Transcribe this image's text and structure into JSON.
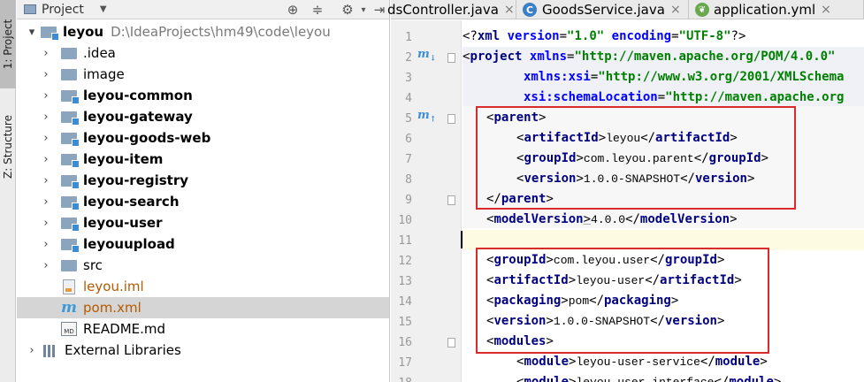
{
  "tool_strip": {
    "project_tab": "1: Project",
    "structure_tab": "Z: Structure"
  },
  "project_panel": {
    "title": "Project",
    "tree": [
      {
        "label": "leyou",
        "path": "D:\\IdeaProjects\\hm49\\code\\leyou",
        "icon": "module-folder-icon"
      },
      {
        "label": ".idea",
        "icon": "folder-icon"
      },
      {
        "label": "image",
        "icon": "folder-icon"
      },
      {
        "label": "leyou-common",
        "icon": "module-folder-icon"
      },
      {
        "label": "leyou-gateway",
        "icon": "module-folder-icon"
      },
      {
        "label": "leyou-goods-web",
        "icon": "module-folder-icon"
      },
      {
        "label": "leyou-item",
        "icon": "module-folder-icon"
      },
      {
        "label": "leyou-registry",
        "icon": "module-folder-icon"
      },
      {
        "label": "leyou-search",
        "icon": "module-folder-icon"
      },
      {
        "label": "leyou-user",
        "icon": "module-folder-icon"
      },
      {
        "label": "leyouupload",
        "icon": "module-folder-icon"
      },
      {
        "label": "src",
        "icon": "folder-icon"
      },
      {
        "label": "leyou.iml",
        "icon": "iml-file-icon"
      },
      {
        "label": "pom.xml",
        "icon": "maven-file-icon"
      },
      {
        "label": "README.md",
        "icon": "markdown-file-icon"
      },
      {
        "label": "External Libraries",
        "icon": "libraries-icon"
      }
    ]
  },
  "editor": {
    "tabs": [
      {
        "label": "dsController.java",
        "icon": ""
      },
      {
        "label": "GoodsService.java",
        "icon": "class-c-icon"
      },
      {
        "label": "application.yml",
        "icon": "spring-leaf-icon"
      }
    ],
    "line_numbers": [
      "1",
      "2",
      "3",
      "4",
      "5",
      "6",
      "7",
      "8",
      "9",
      "10",
      "11",
      "12",
      "13",
      "14",
      "15",
      "16",
      "17",
      "18"
    ],
    "code": {
      "l1": {
        "open": "<?",
        "tag": "xml",
        "a1": "version",
        "v1": "\"1.0\"",
        "a2": "encoding",
        "v2": "\"UTF-8\"",
        "close": "?>"
      },
      "l2": {
        "tag": "project",
        "a1": "xmlns",
        "v1": "\"http://maven.apache.org/POM/4.0.0\""
      },
      "l3": {
        "a1": "xmlns:xsi",
        "v1": "\"http://www.w3.org/2001/XMLSchema"
      },
      "l4": {
        "a1": "xsi:schemaLocation",
        "v1": "\"http://maven.apache.org"
      },
      "l5": {
        "tag": "parent"
      },
      "l6": {
        "tag": "artifactId",
        "value": "leyou"
      },
      "l7": {
        "tag": "groupId",
        "value": "com.leyou.parent"
      },
      "l8": {
        "tag": "version",
        "value": "1.0.0-SNAPSHOT"
      },
      "l9": {
        "tag": "parent"
      },
      "l10": {
        "tag": "modelVersion",
        "value": "4.0.0"
      },
      "l12": {
        "tag": "groupId",
        "value": "com.leyou.user"
      },
      "l13": {
        "tag": "artifactId",
        "value": "leyou-user"
      },
      "l14": {
        "tag": "packaging",
        "value": "pom"
      },
      "l15": {
        "tag": "version",
        "value": "1.0.0-SNAPSHOT"
      },
      "l16": {
        "tag": "modules"
      },
      "l17": {
        "tag": "module",
        "value": "leyou-user-service"
      },
      "l18": {
        "tag": "module",
        "value": "leyou-user-interface"
      }
    }
  },
  "colors": {
    "annotation_box": "#d92b2b",
    "xml_tag": "#000080",
    "xml_attr": "#0000ff",
    "xml_string": "#008000",
    "selection": "#d5d5d5"
  }
}
